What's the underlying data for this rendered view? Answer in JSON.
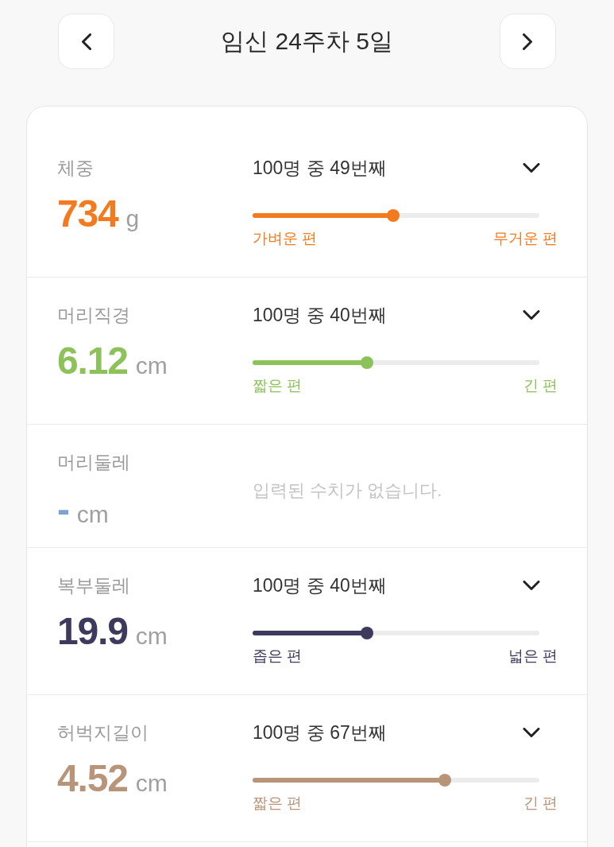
{
  "header": {
    "title": "임신 24주차 5일"
  },
  "measurements": [
    {
      "kind": "ranked",
      "label": "체중",
      "value": "734",
      "unit": "g",
      "color": "#f47a1f",
      "rank": "100명 중 49번째",
      "expanded": false,
      "level": 0.49,
      "low_label": "가벼운 편",
      "high_label": "무거운 편"
    },
    {
      "kind": "ranked",
      "label": "머리직경",
      "value": "6.12",
      "unit": "cm",
      "color": "#8dc15a",
      "rank": "100명 중 40번째",
      "expanded": false,
      "level": 0.4,
      "low_label": "짧은 편",
      "high_label": "긴 편"
    },
    {
      "kind": "empty",
      "label": "머리둘레",
      "value": "-",
      "unit": "cm",
      "color": "#7fa3cf",
      "message": "입력된 수치가 없습니다."
    },
    {
      "kind": "ranked",
      "label": "복부둘레",
      "value": "19.9",
      "unit": "cm",
      "color": "#3d3a5e",
      "rank": "100명 중 40번째",
      "expanded": false,
      "level": 0.4,
      "low_label": "좁은 편",
      "high_label": "넓은 편"
    },
    {
      "kind": "ranked",
      "label": "허벅지길이",
      "value": "4.52",
      "unit": "cm",
      "color": "#b89479",
      "rank": "100명 중 67번째",
      "expanded": false,
      "level": 0.67,
      "low_label": "짧은 편",
      "high_label": "긴 편"
    }
  ]
}
